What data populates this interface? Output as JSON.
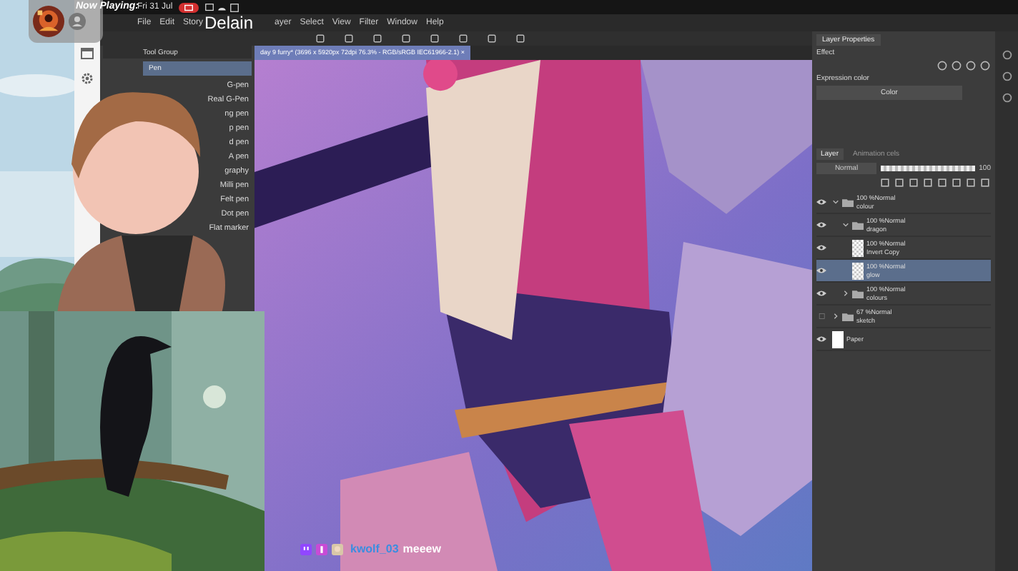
{
  "overlay": {
    "now_playing": "Now Playing:",
    "song": "Delain"
  },
  "system_bar": {
    "date": "Fri 31 Jul"
  },
  "menu": [
    "File",
    "Edit",
    "Story",
    "ayer",
    "Select",
    "View",
    "Filter",
    "Window",
    "Help"
  ],
  "tool_panel": {
    "title": "Tool Group",
    "sub_tool": "Pen",
    "brushes": [
      {
        "label": "G-pen",
        "selected": false
      },
      {
        "label": "Real G-Pen",
        "selected": false
      },
      {
        "label": "ng pen",
        "selected": false
      },
      {
        "label": "p pen",
        "selected": false
      },
      {
        "label": "d pen",
        "selected": false
      },
      {
        "label": "A pen",
        "selected": false
      },
      {
        "label": "graphy",
        "selected": false
      },
      {
        "label": "Milli pen",
        "selected": false
      },
      {
        "label": "Felt pen",
        "selected": false
      },
      {
        "label": "Dot pen",
        "selected": false
      },
      {
        "label": "Flat marker",
        "selected": false
      }
    ]
  },
  "canvas": {
    "tab": "day 9 furry* (3696 x 5920px 72dpi 76.3% - RGB/sRGB IEC61966-2.1)",
    "close": "×"
  },
  "layer_properties": {
    "title": "Layer Properties",
    "effect_label": "Effect",
    "expression_label": "Expression color",
    "expression_value": "Color"
  },
  "layer_panel": {
    "tabs": [
      {
        "label": "Layer",
        "selected": true
      },
      {
        "label": "Animation cels",
        "selected": false
      }
    ],
    "blend": "Normal",
    "opacity": {
      "level": 1,
      "reading": "100"
    },
    "layers": [
      {
        "kind": "folder",
        "blend": "100 %Normal",
        "name": "colour",
        "visible": true,
        "expanded": true,
        "selected": false,
        "children": [
          {
            "kind": "folder",
            "blend": "100 %Normal",
            "name": "dragon",
            "visible": true,
            "expanded": true,
            "selected": false,
            "children": [
              {
                "kind": "layer",
                "blend": "100 %Normal",
                "name": "Invert Copy",
                "visible": true,
                "selected": false
              },
              {
                "kind": "layer",
                "blend": "100 %Normal",
                "name": "glow",
                "visible": true,
                "selected": true
              }
            ]
          },
          {
            "kind": "folder",
            "blend": "100 %Normal",
            "name": "colours",
            "visible": true,
            "expanded": false,
            "selected": false
          }
        ]
      },
      {
        "kind": "folder",
        "blend": "67 %Normal",
        "name": "sketch",
        "visible": false,
        "expanded": false,
        "selected": false
      },
      {
        "kind": "paper",
        "name": "Paper",
        "visible": true,
        "selected": false
      }
    ]
  },
  "chat": {
    "user": "kwolf_03",
    "message": "meeew"
  }
}
